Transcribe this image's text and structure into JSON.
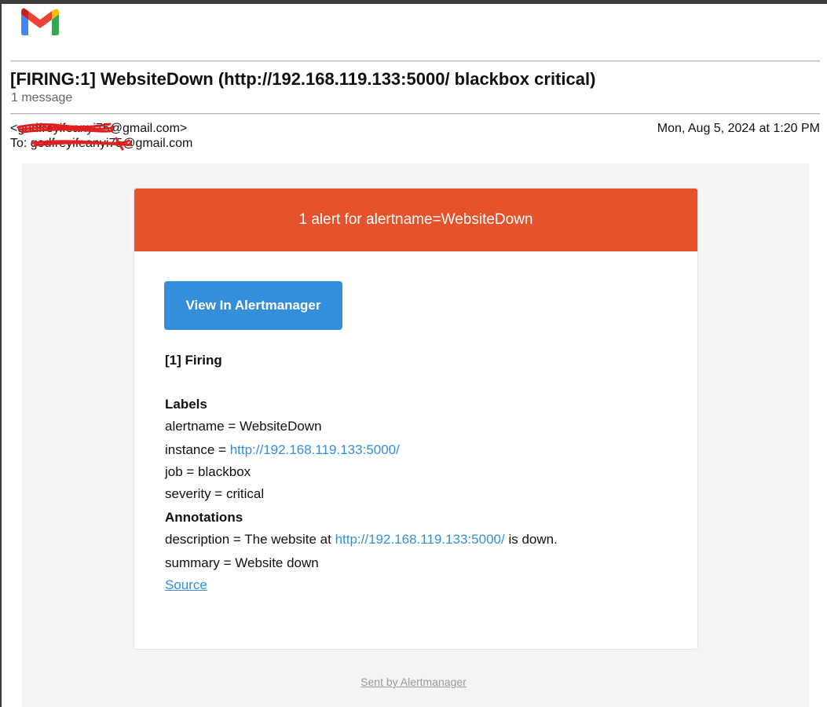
{
  "subject": "[FIRING:1] WebsiteDown (http://192.168.119.133:5000/ blackbox critical)",
  "message_count": "1 message",
  "from": "<godfreyifeanyi75@gmail.com>",
  "to": "To: godfreyifeanyi75@gmail.com",
  "date": "Mon, Aug 5, 2024 at 1:20 PM",
  "alert_header": "1 alert for alertname=WebsiteDown",
  "view_button": "View In Alertmanager",
  "firing_title": "[1] Firing",
  "labels_title": "Labels",
  "labels": {
    "alertname": "alertname = WebsiteDown",
    "instance_prefix": "instance = ",
    "instance_link": "http://192.168.119.133:5000/",
    "job": "job = blackbox",
    "severity": "severity = critical"
  },
  "annotations_title": "Annotations",
  "annotations": {
    "description_prefix": "description = The website at ",
    "description_link": "http://192.168.119.133:5000/",
    "description_suffix": " is down.",
    "summary": "summary = Website down"
  },
  "source_link": "Source",
  "footer": "Sent by Alertmanager",
  "colors": {
    "header_bg": "#e6522c",
    "button_bg": "#348eda",
    "link": "#348eda"
  },
  "icons": {
    "logo": "gmail-logo",
    "redaction": "red-scribble-redaction"
  }
}
